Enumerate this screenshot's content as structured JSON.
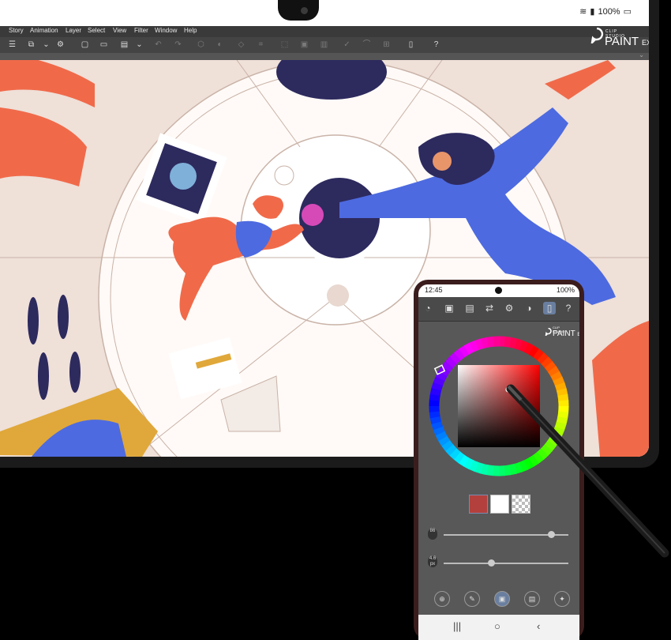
{
  "tablet": {
    "status": {
      "wifi_icon": "wifi-icon",
      "signal_icon": "signal-icon",
      "battery_text": "100%",
      "battery_icon": "battery-icon"
    },
    "menu": [
      "Story",
      "Animation",
      "Layer",
      "Select",
      "View",
      "Filter",
      "Window",
      "Help"
    ],
    "logo": {
      "studio": "CLIP STUDIO",
      "paint": "PAINT",
      "ex": "EX"
    }
  },
  "phone": {
    "status": {
      "time": "12:45",
      "battery_text": "100%"
    },
    "logo": {
      "studio": "CLIP STUDIO",
      "paint": "PAINT",
      "ex": "EX"
    },
    "colors": {
      "main": "#b3403d",
      "sub": "#ffffff",
      "transparent": "transparent"
    },
    "sliders": {
      "brush_size": "86",
      "opacity": "4.6 px",
      "brush_size_level": 0.86,
      "opacity_level": 0.38
    },
    "nav": {
      "recent": "|||",
      "home": "○",
      "back": "‹"
    }
  }
}
